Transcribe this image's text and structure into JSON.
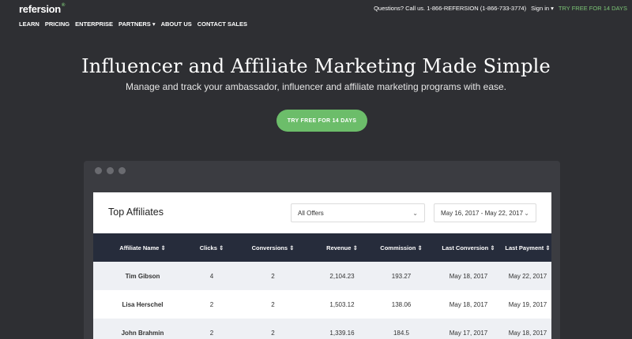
{
  "brand": {
    "logo": "refersion",
    "mark": "®"
  },
  "topbar": {
    "phone": "Questions? Call us. 1-866-REFERSION (1-866-733-3774)",
    "signin": "Sign in ▾",
    "try_label": "TRY FREE FOR 14 DAYS"
  },
  "nav": {
    "items": [
      "LEARN",
      "PRICING",
      "ENTERPRISE",
      "PARTNERS ▾",
      "ABOUT US",
      "CONTACT SALES"
    ]
  },
  "hero": {
    "title": "Influencer and Affiliate Marketing Made Simple",
    "subtitle": "Manage and track your ambassador, influencer and affiliate marketing programs with ease.",
    "cta": "TRY FREE FOR 14 DAYS"
  },
  "panel": {
    "title": "Top Affiliates",
    "offer_filter": "All Offers",
    "date_filter": "May 16, 2017 - May 22, 2017"
  },
  "table": {
    "columns": [
      "Affiliate Name ⇕",
      "Clicks ⇕",
      "Conversions ⇕",
      "Revenue ⇕",
      "Commission ⇕",
      "Last Conversion ⇕",
      "Last Payment ⇕"
    ],
    "rows": [
      [
        "Tim Gibson",
        "4",
        "2",
        "2,104.23",
        "193.27",
        "May 18, 2017",
        "May 22, 2017"
      ],
      [
        "Lisa Herschel",
        "2",
        "2",
        "1,503.12",
        "138.06",
        "May 18, 2017",
        "May 19, 2017"
      ],
      [
        "John Brahmin",
        "2",
        "2",
        "1,339.16",
        "184.5",
        "May 17, 2017",
        "May 18, 2017"
      ]
    ]
  },
  "colors": {
    "background": "#2e2f33",
    "accent": "#6cbd6a",
    "table_header": "#262c3b"
  }
}
